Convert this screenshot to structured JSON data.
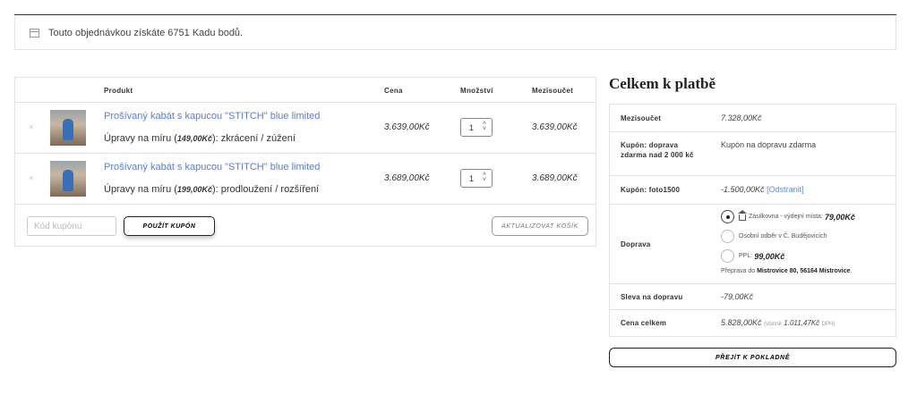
{
  "notice": {
    "text": "Touto objednávkou získáte 6751 Kadu bodů."
  },
  "cart": {
    "headers": {
      "product": "Produkt",
      "price": "Cena",
      "qty": "Množství",
      "subtotal": "Mezisoučet"
    },
    "items": [
      {
        "remove": "×",
        "name": "Prošívaný kabát s kapucou \"STITCH\" blue limited",
        "meta_prefix": "Úpravy na míru (",
        "meta_price": "149,00Kč",
        "meta_suffix": "): zkrácení / zúžení",
        "price": "3.639,00Kč",
        "qty": "1",
        "subtotal": "3.639,00Kč"
      },
      {
        "remove": "×",
        "name": "Prošívaný kabát s kapucou \"STITCH\" blue limited",
        "meta_prefix": "Úpravy na míru (",
        "meta_price": "199,00Kč",
        "meta_suffix": "): prodloužení / rozšíření",
        "price": "3.689,00Kč",
        "qty": "1",
        "subtotal": "3.689,00Kč"
      }
    ],
    "coupon_placeholder": "Kód kupónu",
    "apply_label": "POUŽÍT KUPÓN",
    "update_label": "AKTUALIZOVAT KOŠÍK"
  },
  "totals": {
    "title": "Celkem k platbě",
    "subtotal_label": "Mezisoučet",
    "subtotal_value": "7.328,00Kč",
    "coupon1_label": "Kupón: doprava zdarma nad 2 000 kč",
    "coupon1_value": "Kupón na dopravu zdarma",
    "coupon2_label": "Kupón: foto1500",
    "coupon2_value": "-1.500,00Kč",
    "coupon2_remove": "[Odstranit]",
    "shipping_label": "Doprava",
    "shipping_options": [
      {
        "label": "Zásilkovna - výdejní místa:",
        "price": "79,00Kč",
        "selected": true
      },
      {
        "label": "Osobní odběr v Č. Budějovicích",
        "price": "",
        "selected": false
      },
      {
        "label": "PPL:",
        "price": "99,00Kč",
        "selected": false
      }
    ],
    "shipping_dest_prefix": "Přeprava do",
    "shipping_dest": "Mistrovice 80, 56164 Mistrovice",
    "shipping_dest_suffix": ".",
    "discount_label": "Sleva na dopravu",
    "discount_value": "-79,00Kč",
    "total_label": "Cena celkem",
    "total_value": "5.828,00Kč",
    "total_incl_prefix": "(včetně",
    "total_incl_value": "1.011,47Kč",
    "total_incl_suffix": "DPH)",
    "checkout_label": "PŘEJÍT K POKLADNĚ"
  }
}
